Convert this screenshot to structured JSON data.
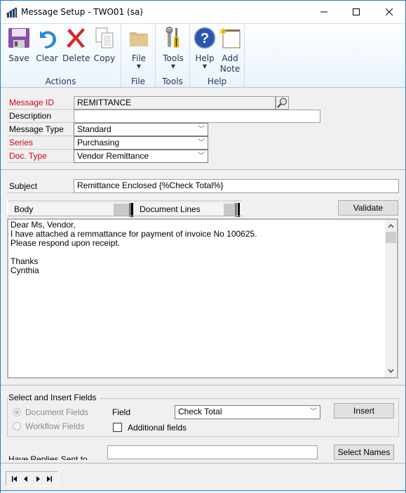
{
  "window": {
    "title": "Message Setup  -  TWO01 (sa)",
    "minimize_glyph": "—",
    "maximize_glyph": "☐",
    "close_glyph": "✕"
  },
  "ribbon": {
    "groups": [
      {
        "label": "Actions",
        "buttons": [
          {
            "label": "Save",
            "icon": "save-icon"
          },
          {
            "label": "Clear",
            "icon": "clear-icon"
          },
          {
            "label": "Delete",
            "icon": "delete-icon"
          },
          {
            "label": "Copy",
            "icon": "copy-icon"
          }
        ]
      },
      {
        "label": "File",
        "buttons": [
          {
            "label": "File",
            "icon": "folder-icon",
            "dropdown": true
          }
        ]
      },
      {
        "label": "Tools",
        "buttons": [
          {
            "label": "Tools",
            "icon": "tools-icon",
            "dropdown": true
          }
        ]
      },
      {
        "label": "Help",
        "buttons": [
          {
            "label": "Help",
            "icon": "help-icon",
            "dropdown": true
          },
          {
            "label_line1": "Add",
            "label_line2": "Note",
            "icon": "add-note-icon"
          }
        ]
      }
    ],
    "dropdown_glyph": "▼"
  },
  "form": {
    "message_id": {
      "label": "Message ID",
      "value": "REMITTANCE"
    },
    "description": {
      "label": "Description",
      "value": ""
    },
    "message_type": {
      "label": "Message Type",
      "value": "Standard"
    },
    "series": {
      "label": "Series",
      "value": "Purchasing"
    },
    "doc_type": {
      "label": "Doc. Type",
      "value": "Vendor Remittance"
    },
    "subject": {
      "label": "Subject",
      "value": "Remittance Enclosed {%Check Total%}"
    },
    "chevron_glyph": "﹀"
  },
  "tabs": [
    {
      "label": "Body"
    },
    {
      "label": "Document Lines"
    }
  ],
  "validate_label": "Validate",
  "body_text": "Dear Ms, Vendor,\nI have attached a remmattance for payment of invoice No 100625.\nPlease respond upon receipt.\n\nThanks\nCynthia",
  "insert_fields": {
    "title": "Select and Insert Fields",
    "radio_document": "Document Fields",
    "radio_workflow": "Workflow Fields",
    "field_label": "Field",
    "field_value": "Check Total",
    "additional_label": "Additional fields",
    "additional_checked": false,
    "insert_label": "Insert"
  },
  "replies": {
    "label": "Have Replies Sent to",
    "value": "",
    "select_names_label": "Select Names"
  },
  "navigation": {
    "first": "⏮",
    "prev": "◀",
    "next": "▶",
    "last": "⏭"
  }
}
